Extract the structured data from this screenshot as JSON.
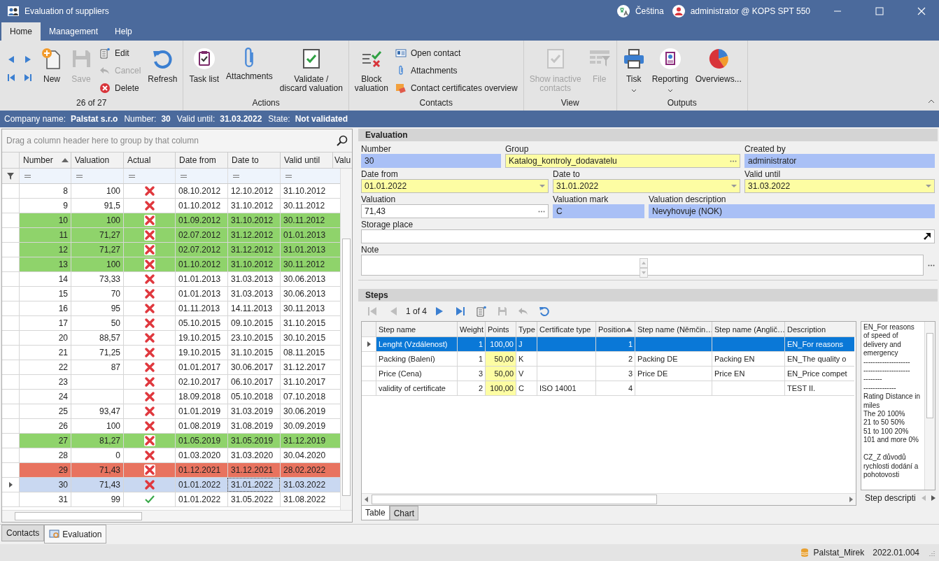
{
  "window": {
    "title": "Evaluation of suppliers",
    "language": "Čeština",
    "user": "administrator @ KOPS SPT 550"
  },
  "ribbon": {
    "tabs": [
      {
        "label": "Home",
        "selected": true
      },
      {
        "label": "Management",
        "selected": false
      },
      {
        "label": "Help",
        "selected": false
      }
    ],
    "groups": [
      {
        "label": "26 of 27",
        "items": [
          {
            "kind": "nav",
            "disabled": false
          },
          {
            "kind": "nav",
            "disabled": false
          },
          {
            "kind": "nav",
            "disabled": false
          },
          {
            "kind": "nav",
            "disabled": false
          },
          {
            "kind": "large",
            "label": "New",
            "disabled": false
          },
          {
            "kind": "large",
            "label": "Save",
            "disabled": true
          },
          {
            "kind": "small",
            "label": "Edit",
            "disabled": false
          },
          {
            "kind": "small",
            "label": "Cancel",
            "disabled": true
          },
          {
            "kind": "small",
            "label": "Delete",
            "disabled": false
          },
          {
            "kind": "large",
            "label": "Refresh",
            "disabled": false
          }
        ]
      },
      {
        "label": "Actions",
        "items": [
          {
            "kind": "large",
            "label": "Task list",
            "disabled": false
          },
          {
            "kind": "large",
            "label": "Attachments",
            "disabled": false
          },
          {
            "kind": "large",
            "label": "Validate /\ndiscard valuation",
            "disabled": false
          }
        ]
      },
      {
        "label": "Contacts",
        "items": [
          {
            "kind": "large",
            "label": "Block\nvaluation",
            "disabled": false
          },
          {
            "kind": "small",
            "label": "Open contact",
            "disabled": false
          },
          {
            "kind": "small",
            "label": "Attachments",
            "disabled": false
          },
          {
            "kind": "small",
            "label": "Contact certificates overview",
            "disabled": false
          }
        ]
      },
      {
        "label": "View",
        "items": [
          {
            "kind": "large",
            "label": "Show inactive\ncontacts",
            "disabled": true
          },
          {
            "kind": "large",
            "label": "File",
            "disabled": true
          }
        ]
      },
      {
        "label": "Outputs",
        "items": [
          {
            "kind": "large",
            "label": "Tisk",
            "disabled": false,
            "menu": true
          },
          {
            "kind": "large",
            "label": "Reporting",
            "disabled": false,
            "menu": true
          },
          {
            "kind": "large",
            "label": "Overviews...",
            "disabled": false,
            "menu": false
          }
        ]
      }
    ]
  },
  "info_bar": [
    {
      "label": "Company name:",
      "value": "Palstat s.r.o"
    },
    {
      "label": "Number:",
      "value": "30"
    },
    {
      "label": "Valid until:",
      "value": "31.03.2022"
    },
    {
      "label": "State:",
      "value": "Not validated"
    }
  ],
  "grid": {
    "group_panel_hint": "Drag a column header here to group by that column",
    "columns": [
      {
        "label": "Number",
        "sorted": true
      },
      {
        "label": "Valuation",
        "sorted": false
      },
      {
        "label": "Actual",
        "sorted": false
      },
      {
        "label": "Date from",
        "sorted": false
      },
      {
        "label": "Date to",
        "sorted": false
      },
      {
        "label": "Valid until",
        "sorted": false
      },
      {
        "label": "Valu",
        "sorted": false
      }
    ],
    "rows": [
      {
        "number": "8",
        "valuation": "100",
        "actual": false,
        "date_from": "08.10.2012",
        "date_to": "12.10.2012",
        "valid_until": "31.10.2012",
        "color": "#ffffff",
        "selected": false
      },
      {
        "number": "9",
        "valuation": "91,5",
        "actual": false,
        "date_from": "01.10.2012",
        "date_to": "31.10.2012",
        "valid_until": "30.11.2012",
        "color": "#ffffff",
        "selected": false
      },
      {
        "number": "10",
        "valuation": "100",
        "actual": false,
        "date_from": "01.09.2012",
        "date_to": "31.10.2012",
        "valid_until": "30.11.2012",
        "color": "#8fd36b",
        "selected": false
      },
      {
        "number": "11",
        "valuation": "71,27",
        "actual": false,
        "date_from": "02.07.2012",
        "date_to": "31.12.2012",
        "valid_until": "01.01.2013",
        "color": "#8fd36b",
        "selected": false
      },
      {
        "number": "12",
        "valuation": "71,27",
        "actual": false,
        "date_from": "02.07.2012",
        "date_to": "31.12.2012",
        "valid_until": "31.01.2013",
        "color": "#8fd36b",
        "selected": false
      },
      {
        "number": "13",
        "valuation": "100",
        "actual": false,
        "date_from": "01.10.2012",
        "date_to": "31.10.2012",
        "valid_until": "30.11.2012",
        "color": "#8fd36b",
        "selected": false
      },
      {
        "number": "14",
        "valuation": "73,33",
        "actual": false,
        "date_from": "01.01.2013",
        "date_to": "31.03.2013",
        "valid_until": "30.06.2013",
        "color": "#ffffff",
        "selected": false
      },
      {
        "number": "15",
        "valuation": "70",
        "actual": false,
        "date_from": "01.01.2013",
        "date_to": "31.03.2013",
        "valid_until": "30.06.2013",
        "color": "#ffffff",
        "selected": false
      },
      {
        "number": "16",
        "valuation": "95",
        "actual": false,
        "date_from": "01.11.2013",
        "date_to": "14.11.2013",
        "valid_until": "30.11.2013",
        "color": "#ffffff",
        "selected": false
      },
      {
        "number": "17",
        "valuation": "50",
        "actual": false,
        "date_from": "05.10.2015",
        "date_to": "09.10.2015",
        "valid_until": "31.10.2015",
        "color": "#ffffff",
        "selected": false
      },
      {
        "number": "20",
        "valuation": "88,57",
        "actual": false,
        "date_from": "19.10.2015",
        "date_to": "23.10.2015",
        "valid_until": "30.10.2015",
        "color": "#ffffff",
        "selected": false
      },
      {
        "number": "21",
        "valuation": "71,25",
        "actual": false,
        "date_from": "19.10.2015",
        "date_to": "31.10.2015",
        "valid_until": "08.11.2015",
        "color": "#ffffff",
        "selected": false
      },
      {
        "number": "22",
        "valuation": "87",
        "actual": false,
        "date_from": "01.01.2017",
        "date_to": "30.06.2017",
        "valid_until": "31.12.2017",
        "color": "#ffffff",
        "selected": false
      },
      {
        "number": "23",
        "actual": false,
        "date_from": "02.10.2017",
        "date_to": "06.10.2017",
        "valid_until": "31.10.2017",
        "color": "#ffffff",
        "selected": false
      },
      {
        "number": "24",
        "actual": false,
        "date_from": "18.09.2018",
        "date_to": "05.10.2018",
        "valid_until": "07.10.2018",
        "color": "#ffffff",
        "selected": false
      },
      {
        "number": "25",
        "valuation": "93,47",
        "actual": false,
        "date_from": "01.01.2019",
        "date_to": "31.03.2019",
        "valid_until": "30.06.2019",
        "color": "#ffffff",
        "selected": false
      },
      {
        "number": "26",
        "valuation": "100",
        "actual": false,
        "date_from": "01.08.2019",
        "date_to": "31.08.2019",
        "valid_until": "30.09.2019",
        "color": "#ffffff",
        "selected": false
      },
      {
        "number": "27",
        "valuation": "81,27",
        "actual": false,
        "date_from": "01.05.2019",
        "date_to": "31.05.2019",
        "valid_until": "31.12.2019",
        "color": "#8fd36b",
        "selected": false
      },
      {
        "number": "28",
        "valuation": "0",
        "actual": false,
        "date_from": "01.03.2020",
        "date_to": "31.03.2020",
        "valid_until": "30.04.2020",
        "color": "#ffffff",
        "selected": false
      },
      {
        "number": "29",
        "valuation": "71,43",
        "actual": false,
        "date_from": "01.12.2021",
        "date_to": "31.12.2021",
        "valid_until": "28.02.2022",
        "color": "#e8735f",
        "selected": false
      },
      {
        "number": "30",
        "valuation": "71,43",
        "actual": false,
        "date_from": "01.01.2022",
        "date_to": "31.01.2022",
        "valid_until": "31.03.2022",
        "color": "#ffffff",
        "selected": true
      },
      {
        "number": "31",
        "valuation": "99",
        "actual": true,
        "date_from": "01.01.2022",
        "date_to": "31.05.2022",
        "valid_until": "31.08.2022",
        "color": "#ffffff",
        "selected": false
      }
    ]
  },
  "evaluation": {
    "title": "Evaluation",
    "rows": [
      [
        {
          "kind": "plain",
          "label": "Number",
          "value": "30",
          "readonly": true,
          "required": false
        },
        {
          "kind": "lookup",
          "label": "Group",
          "value": "Katalog_kontroly_dodavatelu",
          "readonly": false,
          "required": true
        },
        {
          "kind": "plain",
          "label": "Created by",
          "value": "administrator",
          "readonly": true,
          "required": false
        }
      ],
      [
        {
          "kind": "date",
          "label": "Date from",
          "value": "01.01.2022",
          "readonly": false,
          "required": true
        },
        {
          "kind": "date",
          "label": "Date to",
          "value": "31.01.2022",
          "readonly": false,
          "required": true
        },
        {
          "kind": "date",
          "label": "Valid until",
          "value": "31.03.2022",
          "readonly": false,
          "required": true
        }
      ],
      [
        {
          "kind": "lookup",
          "label": "Valuation",
          "value": "71,43",
          "readonly": false,
          "required": false
        },
        {
          "kind": "plain",
          "label": "Valuation mark",
          "value": "C",
          "readonly": true,
          "required": false
        },
        {
          "kind": "plain",
          "label": "Valuation description",
          "value": "Nevyhovuje (NOK)",
          "readonly": true,
          "required": false
        }
      ],
      [
        {
          "kind": "link",
          "label": "Storage place",
          "readonly": false,
          "required": false
        }
      ],
      [
        {
          "kind": "memo",
          "label": "Note",
          "readonly": false,
          "required": false
        }
      ]
    ]
  },
  "steps": {
    "title": "Steps",
    "toolbar": [
      {
        "kind": "first",
        "disabled": true
      },
      {
        "kind": "prev",
        "disabled": true
      },
      {
        "kind": "counter",
        "label": "1 of 4"
      },
      {
        "kind": "next",
        "disabled": false
      },
      {
        "kind": "last",
        "disabled": false
      },
      {
        "kind": "edit",
        "disabled": false
      },
      {
        "kind": "save",
        "disabled": true
      },
      {
        "kind": "undo",
        "disabled": true
      },
      {
        "kind": "refresh",
        "disabled": false
      }
    ],
    "columns": [
      {
        "label": "Step name",
        "sorted": false,
        "highlighted": false
      },
      {
        "label": "Weight",
        "sorted": false,
        "highlighted": false
      },
      {
        "label": "Points",
        "sorted": false,
        "highlighted": true
      },
      {
        "label": "Type",
        "sorted": false,
        "highlighted": false
      },
      {
        "label": "Certificate type",
        "sorted": false,
        "highlighted": false
      },
      {
        "label": "Position",
        "sorted": true,
        "highlighted": false
      },
      {
        "label": "Step name (Němčin…",
        "sorted": false,
        "highlighted": false
      },
      {
        "label": "Step name (Anglič…",
        "sorted": false,
        "highlighted": false
      },
      {
        "label": "Description",
        "sorted": false,
        "highlighted": false
      }
    ],
    "rows": [
      {
        "selected": true,
        "cells": [
          "Lenght (Vzdálenost)",
          "1",
          "100,00",
          "J",
          null,
          "1",
          null,
          null,
          "EN_For reasons"
        ]
      },
      {
        "selected": false,
        "cells": [
          "Packing (Balení)",
          "1",
          "50,00",
          "K",
          null,
          "2",
          "Packing DE",
          "Packing EN",
          "EN_The quality o"
        ]
      },
      {
        "selected": false,
        "cells": [
          "Price (Cena)",
          "3",
          "50,00",
          "V",
          null,
          "3",
          "Price DE",
          "Price EN",
          "EN_Price compet"
        ]
      },
      {
        "selected": false,
        "cells": [
          "validity of certificate",
          "2",
          "100,00",
          "C",
          "ISO 14001",
          "4",
          null,
          null,
          "TEST II."
        ]
      }
    ],
    "description_memo": "EN_For reasons\nof speed of\ndelivery and\nemergency\n--------------------\n--------------------\n--------\n--------------\nRating Distance in\nmiles\nThe 20 100%\n21 to 50 50%\n51 to 100 20%\n101 and more 0%\n\nCZ_Z důvodů\nrychlosti dodání a\npohotovosti",
    "memo_caption": "Step descripti",
    "tabs": [
      {
        "label": "Table",
        "selected": true
      },
      {
        "label": "Chart",
        "selected": false
      }
    ]
  },
  "document_tabs": [
    {
      "label": "Contacts",
      "selected": false
    },
    {
      "label": "Evaluation",
      "selected": true
    }
  ],
  "status_bar": {
    "database": "Palstat_Mirek",
    "version": "2022.01.004"
  }
}
